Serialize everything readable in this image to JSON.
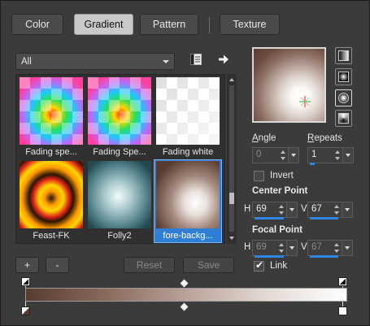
{
  "tabs": [
    {
      "label": "Color",
      "active": false
    },
    {
      "label": "Gradient",
      "active": true
    },
    {
      "label": "Pattern",
      "active": false
    },
    {
      "label": "Texture",
      "active": false
    }
  ],
  "filter": {
    "category_value": "All",
    "library_icon": "library-icon",
    "arrow_icon": "arrow-right-icon"
  },
  "swatches": [
    {
      "label": "Fading spe...",
      "style": "rainbow-checker"
    },
    {
      "label": "Fading Spe...",
      "style": "rainbow-checker"
    },
    {
      "label": "Fading white",
      "style": "white-checker"
    },
    {
      "label": "Feast-FK",
      "style": "rings"
    },
    {
      "label": "Folly2",
      "style": "teal-radial"
    },
    {
      "label": "fore-backg...",
      "style": "fg-bg-radial",
      "selected": true
    }
  ],
  "buttons": {
    "add": "+",
    "remove": "-",
    "reset": "Reset",
    "save": "Save"
  },
  "controls": {
    "angle_label": "Angle",
    "angle_value": "0",
    "repeats_label": "Repeats",
    "repeats_value": "1",
    "invert_label": "Invert",
    "invert_checked": false,
    "center_point_label": "Center Point",
    "center_h_label": "H",
    "center_h": "69",
    "center_v_label": "V",
    "center_v": "67",
    "focal_point_label": "Focal Point",
    "focal_h_label": "H",
    "focal_h": "69",
    "focal_v_label": "V",
    "focal_v": "67",
    "link_label": "Link",
    "link_checked": true
  },
  "gradient": {
    "start_color": "#583b31",
    "end_color": "#ffffff",
    "midpoint_percent": 50
  },
  "colors": {
    "accent": "#2f86e0",
    "selection": "#2f7fd6"
  }
}
